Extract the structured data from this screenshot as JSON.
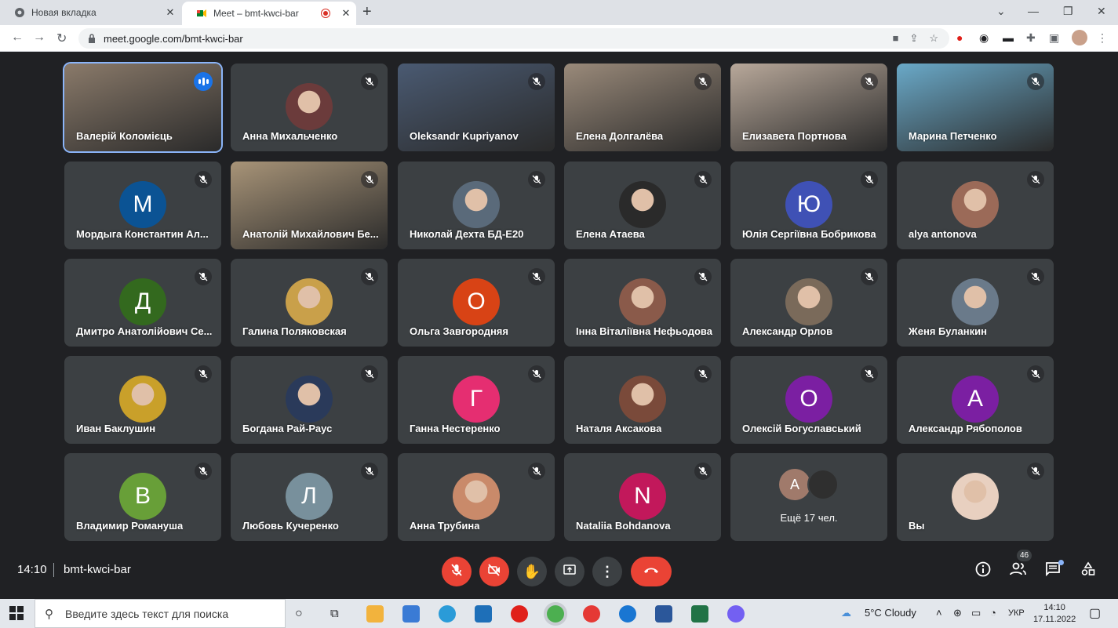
{
  "browser": {
    "tabs": [
      {
        "title": "Новая вкладка"
      },
      {
        "title": "Meet – bmt-kwci-bar"
      }
    ],
    "url": "meet.google.com/bmt-kwci-bar"
  },
  "meeting": {
    "time": "14:10",
    "code": "bmt-kwci-bar",
    "participants_count": "46",
    "more_label": "Ещё 17 чел.",
    "tiles": [
      {
        "name": "Валерій Коломієць",
        "kind": "video",
        "color": "#8a7a6a",
        "speaking": true
      },
      {
        "name": "Анна Михальченко",
        "kind": "photo",
        "color": "#6b3b3b"
      },
      {
        "name": "Oleksandr Kupriyanov",
        "kind": "video",
        "color": "#4a5a72"
      },
      {
        "name": "Елена Долгалёва",
        "kind": "video",
        "color": "#9a8a7a"
      },
      {
        "name": "Елизавета Портнова",
        "kind": "video",
        "color": "#b8a89a"
      },
      {
        "name": "Марина Петченко",
        "kind": "video",
        "color": "#6aa9c8"
      },
      {
        "name": "Мордыга Константин Ал...",
        "kind": "letter",
        "letter": "М",
        "color": "#0b5394"
      },
      {
        "name": "Анатолій Михайлович Бе...",
        "kind": "video",
        "color": "#a89478"
      },
      {
        "name": "Николай Дехта БД-Е20",
        "kind": "photo",
        "color": "#5a6a7a"
      },
      {
        "name": "Елена Атаева",
        "kind": "photo",
        "color": "#2a2a2a"
      },
      {
        "name": "Юлія Сергіївна Бобрикова",
        "kind": "letter",
        "letter": "Ю",
        "color": "#3f51b5"
      },
      {
        "name": "alya antonova",
        "kind": "photo",
        "color": "#9b6a58"
      },
      {
        "name": "Дмитро Анатолійович Се...",
        "kind": "letter",
        "letter": "Д",
        "color": "#33691e"
      },
      {
        "name": "Галина Поляковская",
        "kind": "photo",
        "color": "#c9a04a"
      },
      {
        "name": "Ольга Завгородняя",
        "kind": "letter",
        "letter": "О",
        "color": "#d84315"
      },
      {
        "name": "Інна Віталіївна Нефьодова",
        "kind": "photo",
        "color": "#8a5a4a"
      },
      {
        "name": "Александр Орлов",
        "kind": "photo",
        "color": "#7a6a5a"
      },
      {
        "name": "Женя Буланкин",
        "kind": "photo",
        "color": "#6a7a8a"
      },
      {
        "name": "Иван Баклушин",
        "kind": "photo",
        "color": "#c9a02a"
      },
      {
        "name": "Богдана Рай-Раус",
        "kind": "photo",
        "color": "#2a3a5a"
      },
      {
        "name": "Ганна Нестеренко",
        "kind": "letter",
        "letter": "Г",
        "color": "#e52e71"
      },
      {
        "name": "Наталя Аксакова",
        "kind": "photo",
        "color": "#7a4a3a"
      },
      {
        "name": "Олексій Богуславський",
        "kind": "letter",
        "letter": "О",
        "color": "#7b1fa2"
      },
      {
        "name": "Александр Рябополов",
        "kind": "letter",
        "letter": "А",
        "color": "#7b1fa2"
      },
      {
        "name": "Владимир Романуша",
        "kind": "letter",
        "letter": "В",
        "color": "#689f38"
      },
      {
        "name": "Любовь Кучеренко",
        "kind": "letter",
        "letter": "Л",
        "color": "#78909c"
      },
      {
        "name": "Анна Трубина",
        "kind": "photo",
        "color": "#c98a6a"
      },
      {
        "name": "Nataliia Bohdanova",
        "kind": "letter",
        "letter": "N",
        "color": "#c2185b"
      },
      {
        "name": "",
        "kind": "more",
        "letter": "А"
      },
      {
        "name": "Вы",
        "kind": "photo",
        "color": "#e8d0c0"
      }
    ]
  },
  "taskbar": {
    "search_placeholder": "Введите здесь текст для поиска",
    "weather": "5°C  Cloudy",
    "lang": "УКР",
    "time": "14:10",
    "date": "17.11.2022"
  }
}
